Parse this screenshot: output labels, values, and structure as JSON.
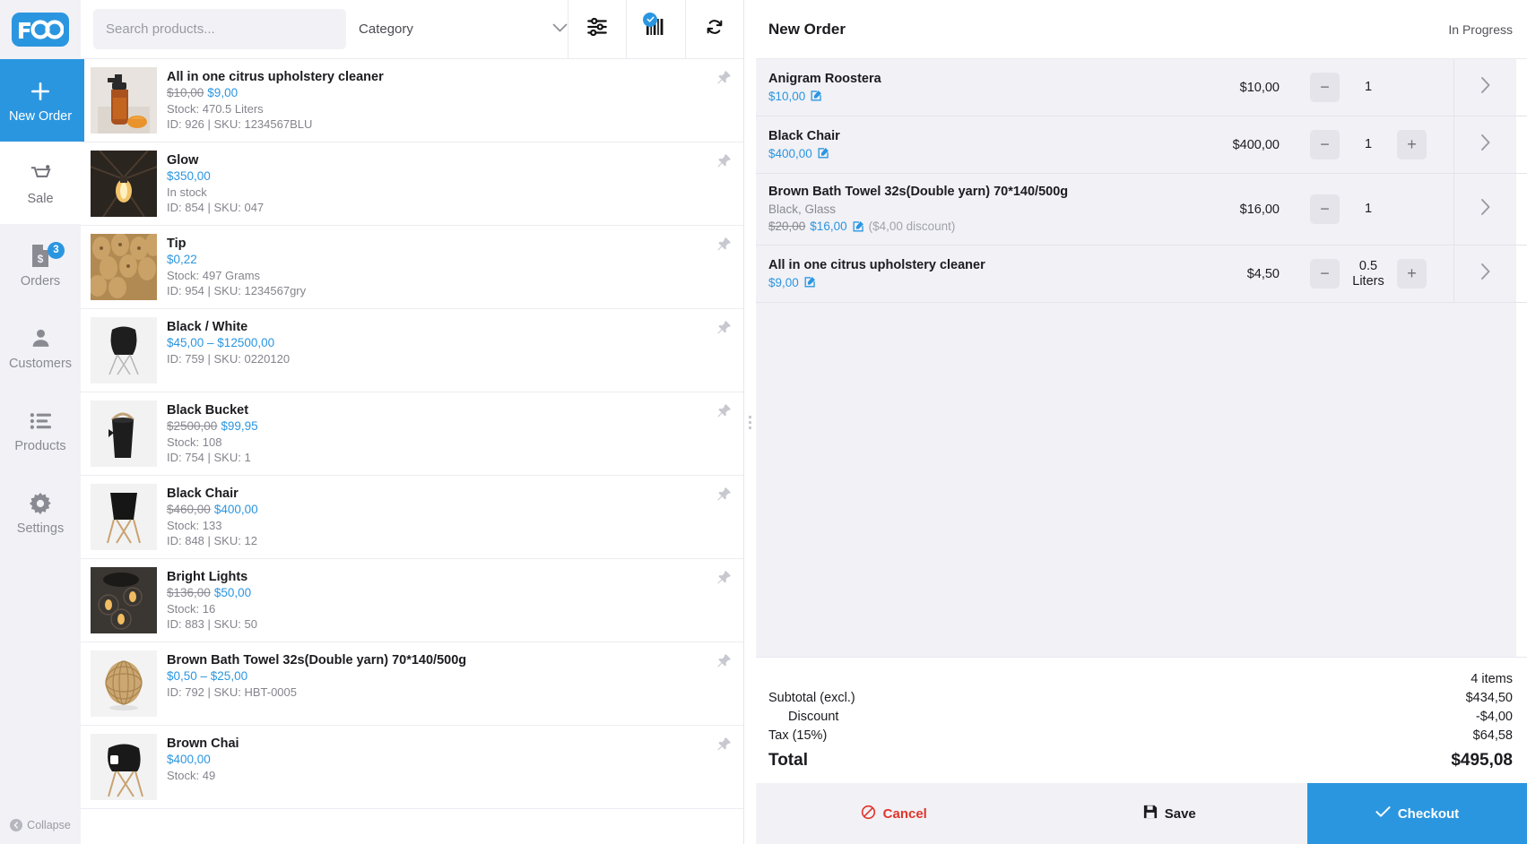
{
  "brand": {
    "name": "FOO",
    "color": "#2b96e0"
  },
  "sidebar": {
    "items": [
      {
        "label": "New Order",
        "icon": "plus-icon",
        "active": true,
        "badge": ""
      },
      {
        "label": "Sale",
        "icon": "cart-icon",
        "active": false,
        "badge": ""
      },
      {
        "label": "Orders",
        "icon": "receipt-icon",
        "active": false,
        "badge": "3"
      },
      {
        "label": "Customers",
        "icon": "person-icon",
        "active": false,
        "badge": ""
      },
      {
        "label": "Products",
        "icon": "list-icon",
        "active": false,
        "badge": ""
      },
      {
        "label": "Settings",
        "icon": "gear-icon",
        "active": false,
        "badge": ""
      }
    ],
    "collapse_label": "Collapse"
  },
  "toolbar": {
    "search_placeholder": "Search products...",
    "search_value": "",
    "category_label": "Category",
    "filter_icon": "sliders-icon",
    "barcode_icon": "barcode-icon",
    "refresh_icon": "refresh-icon"
  },
  "products": [
    {
      "name": "All in one citrus upholstery cleaner",
      "old_price": "$10,00",
      "price": "$9,00",
      "stock": "Stock: 470.5 Liters",
      "idsku": "ID: 926 | SKU: 1234567BLU",
      "selected": true,
      "thumb": "spray-bottle"
    },
    {
      "name": "Glow",
      "old_price": "",
      "price": "$350,00",
      "stock": "In stock",
      "idsku": "ID: 854 | SKU: 047",
      "selected": false,
      "thumb": "bulb-cage"
    },
    {
      "name": "Tip",
      "old_price": "",
      "price": "$0,22",
      "stock": "Stock: 497 Grams",
      "idsku": "ID: 954 | SKU: 1234567gry",
      "selected": false,
      "thumb": "wood-beads"
    },
    {
      "name": "Black / White",
      "old_price": "",
      "price": "$45,00 – $12500,00",
      "stock": "",
      "idsku": "ID: 759 | SKU: 0220120",
      "selected": false,
      "thumb": "chair-dark"
    },
    {
      "name": "Black Bucket",
      "old_price": "$2500,00",
      "price": "$99,95",
      "stock": "Stock: 108",
      "idsku": "ID: 754 | SKU: 1",
      "selected": false,
      "thumb": "bucket"
    },
    {
      "name": "Black Chair",
      "old_price": "$460,00",
      "price": "$400,00",
      "stock": "Stock: 133",
      "idsku": "ID: 848 | SKU: 12",
      "selected": false,
      "thumb": "chair-wood"
    },
    {
      "name": "Bright Lights",
      "old_price": "$136,00",
      "price": "$50,00",
      "stock": "Stock: 16",
      "idsku": "ID: 883 | SKU: 50",
      "selected": false,
      "thumb": "lamp-cluster"
    },
    {
      "name": "Brown Bath Towel 32s(Double yarn) 70*140/500g",
      "old_price": "",
      "price": "$0,50 – $25,00",
      "stock": "",
      "idsku": "ID: 792 | SKU: HBT-0005",
      "selected": false,
      "thumb": "rattan-ball"
    },
    {
      "name": "Brown Chai",
      "old_price": "",
      "price": "$400,00",
      "stock": "Stock: 49",
      "idsku": "",
      "selected": false,
      "thumb": "armchair"
    }
  ],
  "order": {
    "title": "New Order",
    "status": "In Progress",
    "items": [
      {
        "name": "Anigram Roostera",
        "variant": "",
        "old_price": "",
        "price": "$10,00",
        "discount": "",
        "line_total": "$10,00",
        "qty": "1",
        "qty_unit": "",
        "has_plus": false
      },
      {
        "name": "Black Chair",
        "variant": "",
        "old_price": "",
        "price": "$400,00",
        "discount": "",
        "line_total": "$400,00",
        "qty": "1",
        "qty_unit": "",
        "has_plus": true
      },
      {
        "name": "Brown Bath Towel 32s(Double yarn) 70*140/500g",
        "variant": "Black, Glass",
        "old_price": "$20,00",
        "price": "$16,00",
        "discount": "($4,00 discount)",
        "line_total": "$16,00",
        "qty": "1",
        "qty_unit": "",
        "has_plus": false
      },
      {
        "name": "All in one citrus upholstery cleaner",
        "variant": "",
        "old_price": "",
        "price": "$9,00",
        "discount": "",
        "line_total": "$4,50",
        "qty": "0.5",
        "qty_unit": "Liters",
        "has_plus": true
      }
    ],
    "summary": {
      "items_count": "4 items",
      "subtotal_label": "Subtotal (excl.)",
      "subtotal_value": "$434,50",
      "discount_label": "Discount",
      "discount_value": "-$4,00",
      "tax_label": "Tax (15%)",
      "tax_value": "$64,58",
      "total_label": "Total",
      "total_value": "$495,08"
    },
    "actions": {
      "cancel_label": "Cancel",
      "save_label": "Save",
      "checkout_label": "Checkout"
    }
  }
}
